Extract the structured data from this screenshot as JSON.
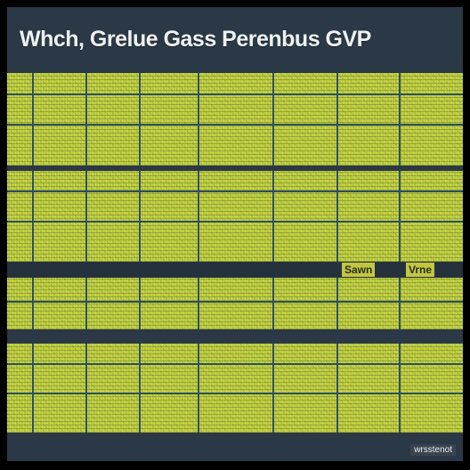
{
  "title": "Whch, Grelue Gass Perenbus GVP",
  "strip_label_left": "Sawn",
  "strip_label_right": "Vrne",
  "footer_text": "wrsstenot",
  "colors": {
    "background": "#2b3845",
    "panel_fill": "#b9c93a",
    "grid_line": "#2c4f5f"
  }
}
